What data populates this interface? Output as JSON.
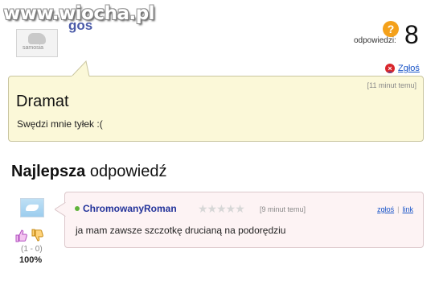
{
  "watermark": "www.wiocha.pl",
  "asker": {
    "avatar_text": "samosia",
    "name": "gos"
  },
  "answers": {
    "label": "odpowiedzi:",
    "count": "8",
    "icon": "question-mark-icon"
  },
  "report": {
    "label": "Zgłoś"
  },
  "question": {
    "time": "[11 minut temu]",
    "title": "Dramat",
    "body": "Swędzi mnie tyłek :("
  },
  "best_answer": {
    "heading_bold": "Najlepsza",
    "heading_rest": " odpowiedź"
  },
  "answer": {
    "author": "ChromowanyRoman",
    "stars": "★★★★★",
    "time": "[9 minut temu]",
    "report_label": "zgłoś",
    "link_label": "link",
    "separator": "|",
    "body": "ja mam zawsze szczotkę drucianą na podorędziu"
  },
  "votes": {
    "counts": "(1 - 0)",
    "percent": "100%"
  },
  "colors": {
    "question_bg": "#fbf8d8",
    "answer_bg": "#fdf3f4",
    "link": "#1a55c8",
    "author": "#23339a"
  }
}
